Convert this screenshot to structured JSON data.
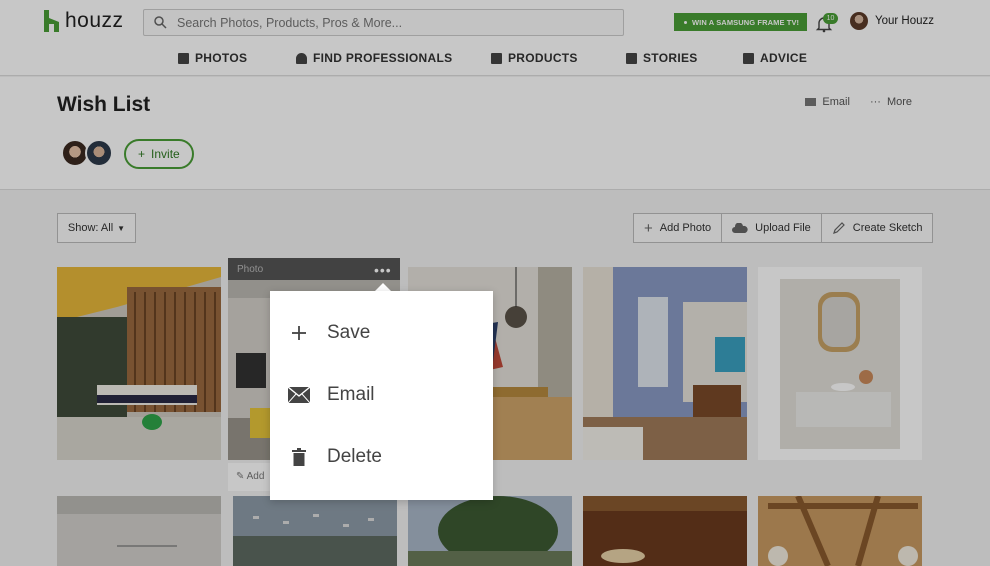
{
  "header": {
    "logo_text": "houzz",
    "search_placeholder": "Search Photos, Products, Pros & More...",
    "promo": "WIN A SAMSUNG FRAME TV!",
    "notification_count": "10",
    "user_label": "Your Houzz"
  },
  "nav": {
    "items": [
      {
        "label": "PHOTOS",
        "icon": "photos-icon"
      },
      {
        "label": "FIND PROFESSIONALS",
        "icon": "professional-icon"
      },
      {
        "label": "PRODUCTS",
        "icon": "products-icon"
      },
      {
        "label": "STORIES",
        "icon": "stories-icon"
      },
      {
        "label": "ADVICE",
        "icon": "advice-icon"
      }
    ]
  },
  "page": {
    "title": "Wish List",
    "email_label": "Email",
    "more_label": "More",
    "invite_label": "Invite"
  },
  "toolbar": {
    "show_label": "Show: All",
    "add_photo": "Add Photo",
    "upload_file": "Upload File",
    "create_sketch": "Create Sketch"
  },
  "tile": {
    "caption": "Photo",
    "add_note": "Add"
  },
  "menu": {
    "save": "Save",
    "email": "Email",
    "delete": "Delete"
  },
  "colors": {
    "brand_green": "#4a9e36"
  }
}
